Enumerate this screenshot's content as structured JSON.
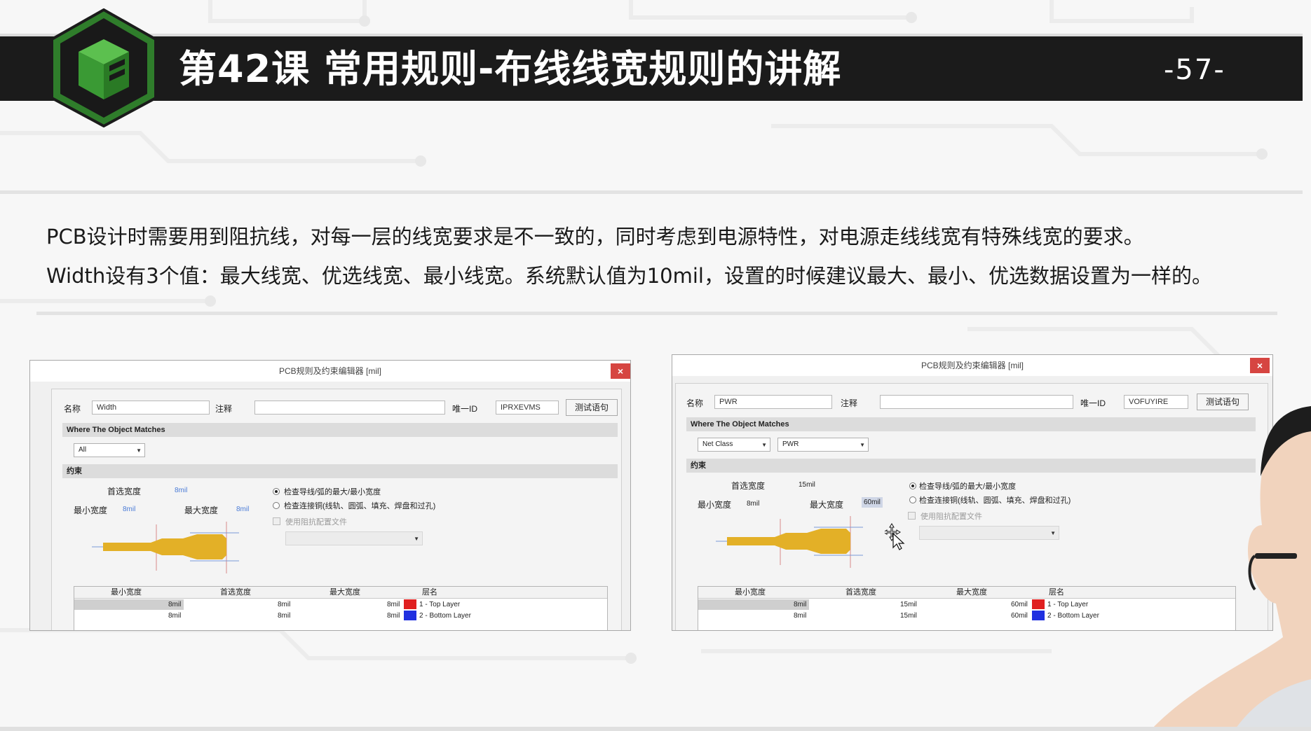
{
  "header": {
    "title": "第42课 常用规则-布线线宽规则的讲解",
    "page_number": "-57-"
  },
  "description": {
    "line1": "PCB设计时需要用到阻抗线，对每一层的线宽要求是不一致的，同时考虑到电源特性，对电源走线线宽有特殊线宽的要求。",
    "line2": "Width设有3个值：最大线宽、优选线宽、最小线宽。系统默认值为10mil，设置的时候建议最大、最小、优选数据设置为一样的。"
  },
  "dialog_left": {
    "title": "PCB规则及约束编辑器 [mil]",
    "close_glyph": "×",
    "name_label": "名称",
    "name_value": "Width",
    "comment_label": "注释",
    "comment_value": "",
    "uid_label": "唯一ID",
    "uid_value": "IPRXEVMS",
    "test_button": "测试语句",
    "where_section": "Where The Object Matches",
    "scope_select": "All",
    "constraint_section": "约束",
    "preferred_label": "首选宽度",
    "preferred_value": "8mil",
    "min_label": "最小宽度",
    "min_value": "8mil",
    "max_label": "最大宽度",
    "max_value": "8mil",
    "radio1": "检查导线/弧的最大/最小宽度",
    "radio2": "检查连接铜(线轨、圆弧、填充、焊盘和过孔)",
    "checkbox_label": "使用阻抗配置文件",
    "table": {
      "headers": [
        "最小宽度",
        "首选宽度",
        "最大宽度",
        "层名"
      ],
      "rows": [
        {
          "min": "8mil",
          "pref": "8mil",
          "max": "8mil",
          "layer": "1 - Top Layer",
          "color": "#e02020"
        },
        {
          "min": "8mil",
          "pref": "8mil",
          "max": "8mil",
          "layer": "2 - Bottom Layer",
          "color": "#2030e0"
        }
      ]
    }
  },
  "dialog_right": {
    "title": "PCB规则及约束编辑器 [mil]",
    "close_glyph": "×",
    "name_label": "名称",
    "name_value": "PWR",
    "comment_label": "注释",
    "comment_value": "",
    "uid_label": "唯一ID",
    "uid_value": "VOFUYIRE",
    "test_button": "测试语句",
    "where_section": "Where The Object Matches",
    "scope_select": "Net Class",
    "class_select": "PWR",
    "constraint_section": "约束",
    "preferred_label": "首选宽度",
    "preferred_value": "15mil",
    "min_label": "最小宽度",
    "min_value": "8mil",
    "max_label": "最大宽度",
    "max_value": "60mil",
    "radio1": "检查导线/弧的最大/最小宽度",
    "radio2": "检查连接铜(线轨、圆弧、填充、焊盘和过孔)",
    "checkbox_label": "使用阻抗配置文件",
    "table": {
      "headers": [
        "最小宽度",
        "首选宽度",
        "最大宽度",
        "层名"
      ],
      "rows": [
        {
          "min": "8mil",
          "pref": "15mil",
          "max": "60mil",
          "layer": "1 - Top Layer",
          "color": "#e02020"
        },
        {
          "min": "8mil",
          "pref": "15mil",
          "max": "60mil",
          "layer": "2 - Bottom Layer",
          "color": "#2030e0"
        }
      ]
    }
  },
  "colors": {
    "header_bg": "#1b1b1b",
    "logo_green": "#3f9a3a",
    "trace_gold": "#e3b027",
    "close_red": "#d64541"
  }
}
